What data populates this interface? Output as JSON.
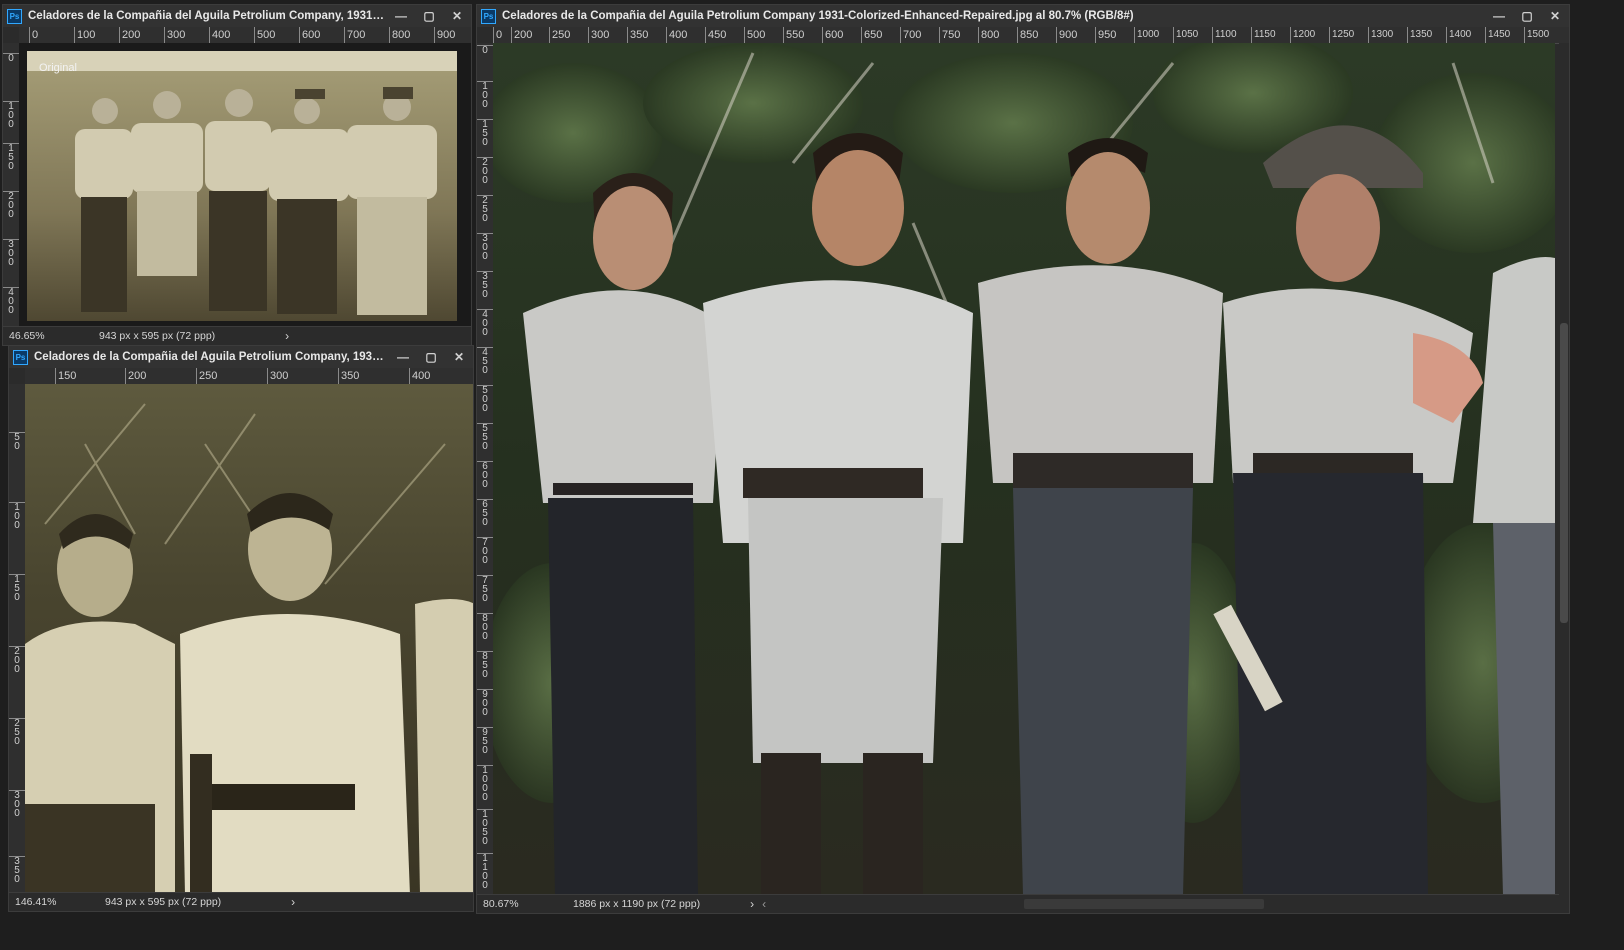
{
  "window_original": {
    "title": "Celadores de la Compañia del Aguila Petrolium Company, 1931.pn...",
    "ruler_h": [
      "0",
      "100",
      "200",
      "300",
      "400",
      "500",
      "600",
      "700",
      "800",
      "900"
    ],
    "ruler_v": [
      "0",
      "1\n0\n0",
      "1\n5\n0",
      "2\n0\n0",
      "3\n0\n0",
      "4\n0\n0",
      "5\n0\n0"
    ],
    "photo_label": "Original",
    "zoom": "46.65%",
    "dims": "943 px x 595 px (72 ppp)"
  },
  "window_detail": {
    "title": "Celadores de la Compañia del Aguila Petrolium Company, 1931.j...",
    "ruler_h": [
      "150",
      "200",
      "250",
      "300",
      "350",
      "400"
    ],
    "ruler_v": [
      "5\n0",
      "1\n0\n0",
      "1\n5\n0",
      "2\n0\n0",
      "2\n5\n0",
      "3\n0\n0",
      "3\n5\n0"
    ],
    "zoom": "146.41%",
    "dims": "943 px x 595 px (72 ppp)"
  },
  "window_colorized": {
    "title": "Celadores de la Compañia del Aguila Petrolium Company 1931-Colorized-Enhanced-Repaired.jpg al 80.7% (RGB/8#)",
    "ruler_h": [
      "0",
      "200",
      "250",
      "300",
      "350",
      "400",
      "450",
      "500",
      "550",
      "600",
      "650",
      "700",
      "750",
      "800",
      "850",
      "900",
      "950",
      "1000",
      "1050",
      "1100",
      "1150",
      "1200",
      "1250",
      "1300",
      "1350",
      "1400",
      "1450",
      "1500"
    ],
    "ruler_v": [
      "0",
      "1\n0\n0",
      "1\n5\n0",
      "2\n0\n0",
      "2\n5\n0",
      "3\n0\n0",
      "3\n5\n0",
      "4\n0\n0",
      "4\n5\n0",
      "5\n0\n0",
      "5\n5\n0",
      "6\n0\n0",
      "6\n5\n0",
      "7\n0\n0",
      "7\n5\n0",
      "8\n0\n0",
      "8\n5\n0",
      "9\n0\n0",
      "9\n5\n0",
      "1\n0\n0\n0",
      "1\n0\n5\n0",
      "1\n1\n0\n0"
    ],
    "zoom": "80.67%",
    "dims": "1886 px x 1190 px (72 ppp)"
  },
  "icons": {
    "minimize": "—",
    "maximize": "▢",
    "close": "✕",
    "status_chevron": "›",
    "scroll_left": "‹"
  },
  "colors": {
    "app_bg": "#1e1e1e",
    "panel_bg": "#2b2b2b",
    "sepia_light": "#cfc6a4",
    "sepia_dark": "#5a5136",
    "foliage": "#2e3a24",
    "shirt": "#c8c9c6",
    "pants": "#2a2c30"
  }
}
